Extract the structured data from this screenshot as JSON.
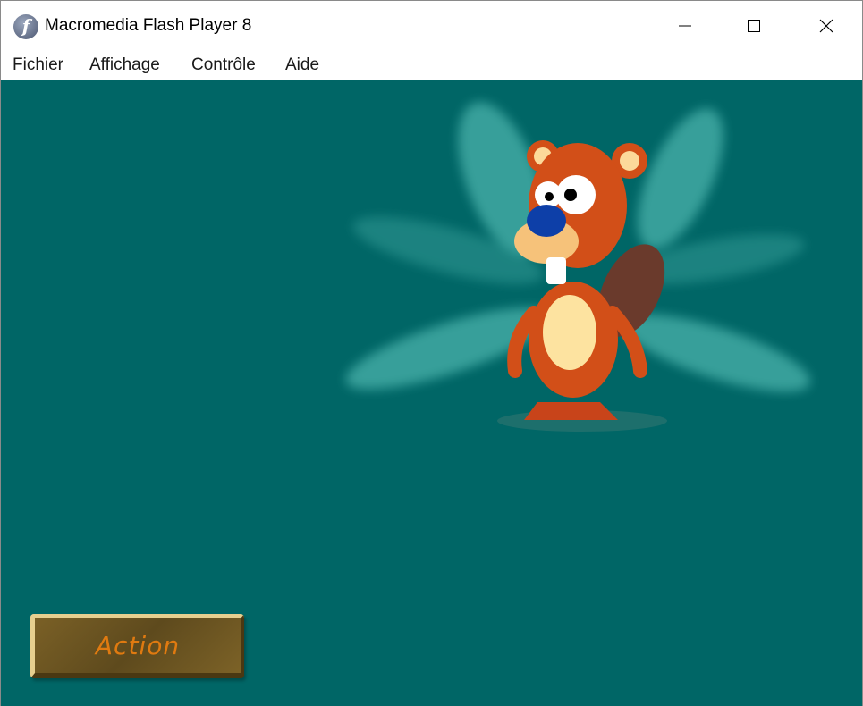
{
  "window": {
    "title": "Macromedia Flash Player 8",
    "icon": "flash-icon"
  },
  "menu": [
    "Fichier",
    "Affichage",
    "Contrôle",
    "Aide"
  ],
  "stage": {
    "background": "#006666",
    "button_label": "Action",
    "character": "beaver-with-wings"
  }
}
